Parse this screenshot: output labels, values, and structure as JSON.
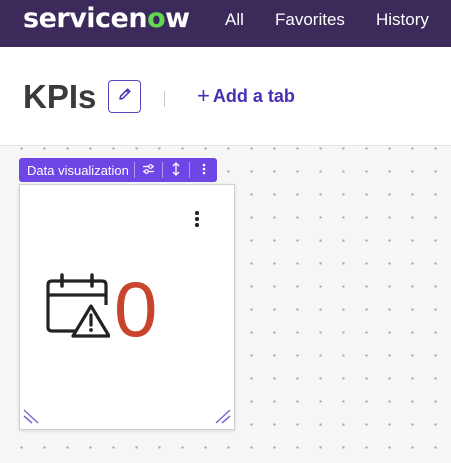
{
  "nav": {
    "logo_text_a": "servicen",
    "logo_text_b": "o",
    "logo_text_c": "w",
    "items": [
      {
        "label": "All"
      },
      {
        "label": "Favorites"
      },
      {
        "label": "History"
      }
    ]
  },
  "header": {
    "title": "KPIs",
    "add_tab_plus": "+",
    "add_tab_label": "Add a tab"
  },
  "widget": {
    "toolbar_label": "Data visualization",
    "value": "0",
    "icon": "calendar-warning-icon"
  },
  "colors": {
    "nav_bg": "#3b2a5a",
    "accent": "#6e46e6",
    "kpi_value": "#c8442c",
    "logo_o": "#62d84e"
  }
}
